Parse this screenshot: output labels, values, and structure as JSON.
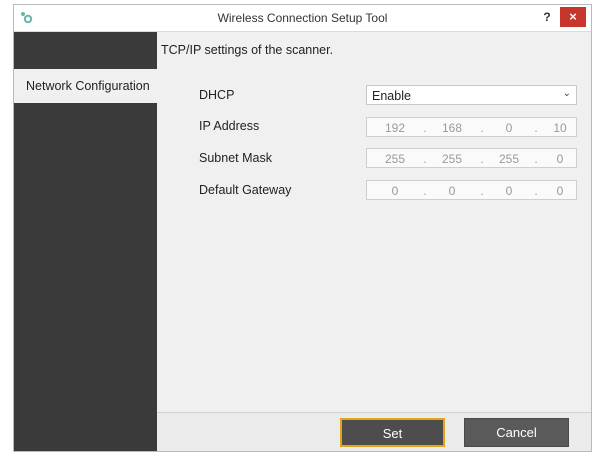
{
  "window": {
    "title": "Wireless Connection Setup Tool",
    "help_label": "?",
    "close_label": "×"
  },
  "sidebar": {
    "items": [
      {
        "label": "Network Configuration"
      }
    ]
  },
  "main": {
    "heading": "TCP/IP settings of the scanner.",
    "dhcp": {
      "label": "DHCP",
      "value": "Enable"
    },
    "ip_address": {
      "label": "IP Address",
      "octets": [
        "192",
        "168",
        "0",
        "10"
      ]
    },
    "subnet_mask": {
      "label": "Subnet Mask",
      "octets": [
        "255",
        "255",
        "255",
        "0"
      ]
    },
    "default_gateway": {
      "label": "Default Gateway",
      "octets": [
        "0",
        "0",
        "0",
        "0"
      ]
    },
    "separator": "."
  },
  "footer": {
    "set_label": "Set",
    "cancel_label": "Cancel"
  },
  "colors": {
    "sidebar_bg": "#3a3a3a",
    "close_button": "#c6362a",
    "focus_outline": "#e1a51a"
  }
}
